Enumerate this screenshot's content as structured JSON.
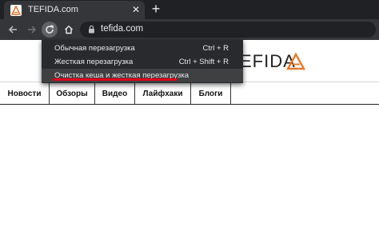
{
  "browser": {
    "tab": {
      "title": "TEFIDA.com",
      "close_glyph": "✕"
    },
    "new_tab_glyph": "+",
    "nav": {
      "back_icon": "back-arrow-icon",
      "forward_icon": "forward-arrow-icon",
      "reload_icon": "reload-icon",
      "home_icon": "home-icon"
    },
    "address_bar": {
      "url": "tefida.com",
      "lock_icon": "lock-icon"
    }
  },
  "reload_menu": {
    "items": [
      {
        "label": "Обычная перезагрузка",
        "shortcut": "Ctrl + R"
      },
      {
        "label": "Жесткая перезагрузка",
        "shortcut": "Ctrl + Shift + R"
      },
      {
        "label": "Очистка кеша и жесткая перезагрузка",
        "shortcut": ""
      }
    ],
    "selected_index": 2,
    "highlight_color": "#e3001b"
  },
  "site": {
    "logo": {
      "visible_text": "EFIDA",
      "accent_color": "#e8792b"
    },
    "nav": [
      "Новости",
      "Обзоры",
      "Видео",
      "Лайфхаки",
      "Блоги"
    ]
  }
}
